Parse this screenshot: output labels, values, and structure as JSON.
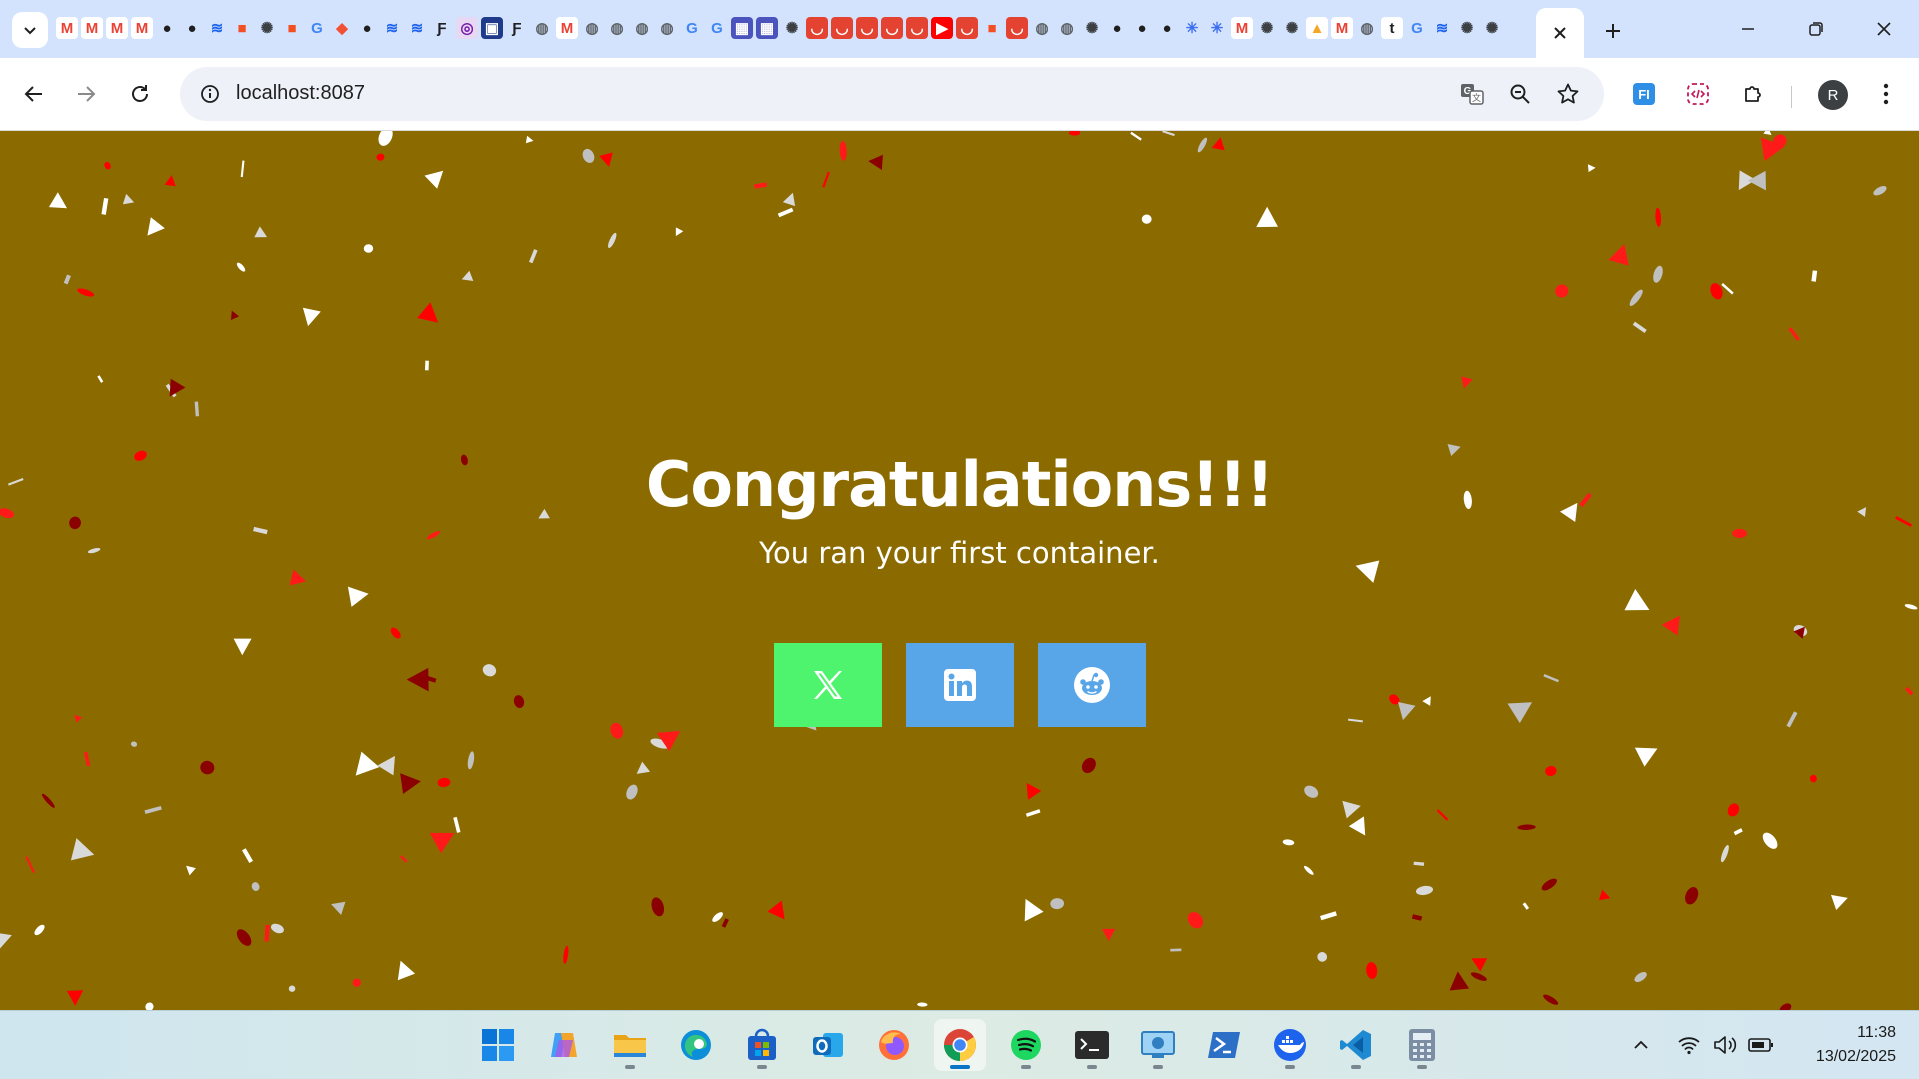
{
  "browser": {
    "tab_favicons": [
      "gmail",
      "gmail",
      "gmail",
      "gmail",
      "github",
      "github",
      "docker",
      "microsoft",
      "openai",
      "microsoft",
      "google",
      "git",
      "github",
      "docker",
      "docker",
      "fandom",
      "onenote",
      "wordmark",
      "fandom",
      "globe",
      "gmail",
      "globe",
      "globe",
      "globe",
      "globe",
      "google",
      "google",
      "teams",
      "teams",
      "openai",
      "todoist",
      "todoist",
      "todoist",
      "todoist",
      "todoist",
      "youtube",
      "todoist",
      "microsoft",
      "todoist",
      "globe",
      "globe",
      "openai",
      "github",
      "github",
      "github",
      "spark",
      "spark",
      "gmail",
      "openai",
      "openai",
      "photo",
      "gmail",
      "globe",
      "tumblr",
      "google",
      "docker",
      "openai",
      "openai"
    ],
    "active_tab_close": "close-icon",
    "new_tab": "+",
    "url": "localhost:8087",
    "profile_initial": "R"
  },
  "page": {
    "background": "#8b6b00",
    "title": "Congratulations!!!",
    "subtitle": "You ran your first container.",
    "share_buttons": [
      {
        "name": "x",
        "color": "#4ef36e",
        "icon": "x-logo-icon"
      },
      {
        "name": "linkedin",
        "color": "#58a6e8",
        "icon": "linkedin-icon"
      },
      {
        "name": "reddit",
        "color": "#58a6e8",
        "icon": "reddit-icon"
      }
    ]
  },
  "taskbar": {
    "apps": [
      "start",
      "copilot",
      "file-explorer",
      "edge",
      "microsoft-store",
      "outlook",
      "firefox",
      "chrome",
      "spotify",
      "terminal",
      "remote-desktop",
      "powershell",
      "docker-desktop",
      "vscode",
      "calculator"
    ],
    "active_app": "chrome",
    "time": "11:38",
    "date": "13/02/2025"
  }
}
